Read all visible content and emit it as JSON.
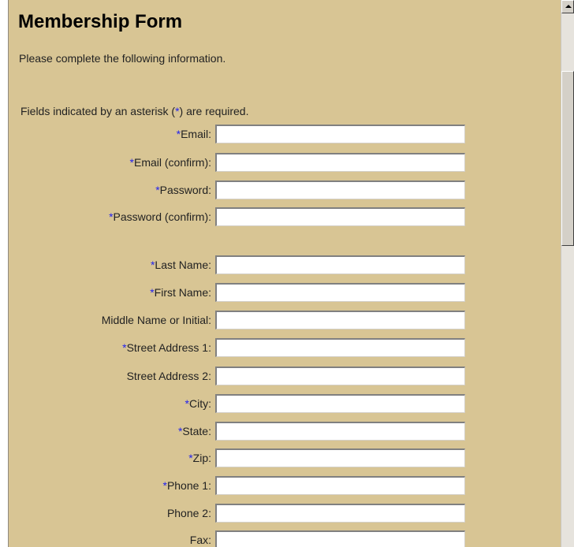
{
  "form": {
    "title": "Membership Form",
    "intro": "Please complete the following information.",
    "required_note_prefix": "Fields indicated by an asterisk (",
    "required_marker": "*",
    "required_note_suffix": ") are required.",
    "fields": [
      {
        "required": "*",
        "label": "Email:",
        "value": ""
      },
      {
        "required": "*",
        "label": "Email (confirm):",
        "value": ""
      },
      {
        "required": "*",
        "label": "Password:",
        "value": ""
      },
      {
        "required": "*",
        "label": "Password (confirm):",
        "value": ""
      },
      {
        "required": "*",
        "label": "Last Name:",
        "value": ""
      },
      {
        "required": "*",
        "label": "First Name:",
        "value": ""
      },
      {
        "required": "",
        "label": "Middle Name or Initial:",
        "value": ""
      },
      {
        "required": "*",
        "label": "Street Address 1:",
        "value": ""
      },
      {
        "required": "",
        "label": "Street Address 2:",
        "value": ""
      },
      {
        "required": "*",
        "label": "City:",
        "value": ""
      },
      {
        "required": "*",
        "label": "State:",
        "value": ""
      },
      {
        "required": "*",
        "label": "Zip:",
        "value": ""
      },
      {
        "required": "*",
        "label": "Phone 1:",
        "value": ""
      },
      {
        "required": "",
        "label": "Phone 2:",
        "value": ""
      },
      {
        "required": "",
        "label": "Fax:",
        "value": ""
      }
    ]
  },
  "colors": {
    "panel_background": "#d8c594",
    "required_marker": "#2222ee"
  }
}
